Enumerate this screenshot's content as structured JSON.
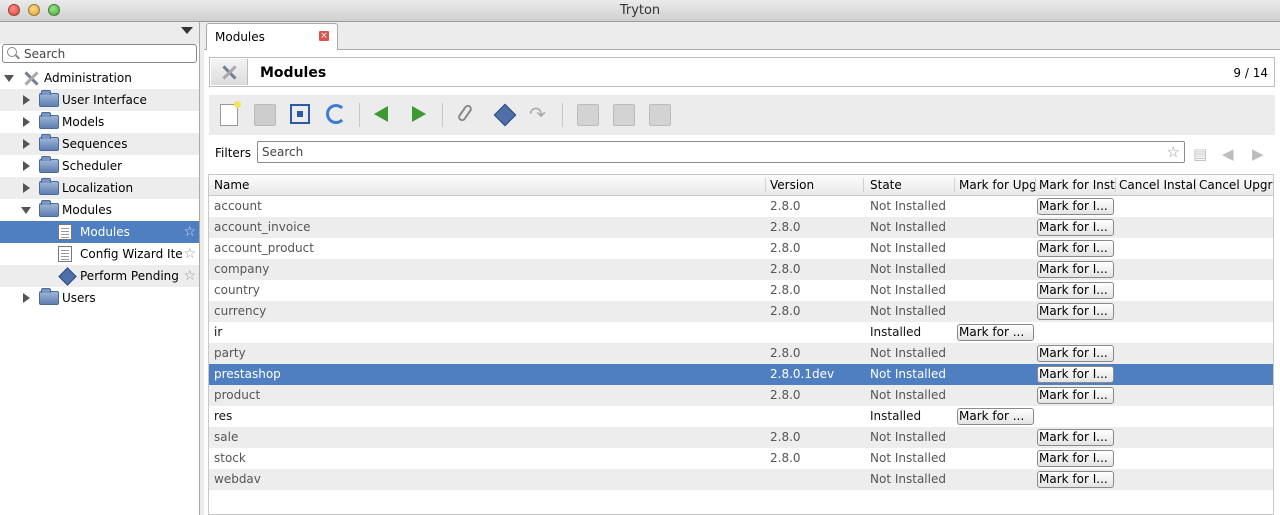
{
  "window": {
    "title": "Tryton"
  },
  "sidebar": {
    "search_placeholder": "Search",
    "items": [
      {
        "label": "Administration",
        "icon": "tools-icon"
      },
      {
        "label": "User Interface",
        "icon": "folder-icon"
      },
      {
        "label": "Models",
        "icon": "folder-icon"
      },
      {
        "label": "Sequences",
        "icon": "folder-icon"
      },
      {
        "label": "Scheduler",
        "icon": "folder-icon"
      },
      {
        "label": "Localization",
        "icon": "folder-icon"
      },
      {
        "label": "Modules",
        "icon": "folder-icon"
      },
      {
        "label": "Modules",
        "icon": "document-icon",
        "selected": true
      },
      {
        "label": "Config Wizard Ite",
        "icon": "document-icon"
      },
      {
        "label": "Perform Pending",
        "icon": "action-icon"
      },
      {
        "label": "Users",
        "icon": "folder-icon"
      }
    ]
  },
  "tab": {
    "label": "Modules",
    "close": "×"
  },
  "header": {
    "title": "Modules",
    "record_count": "9 / 14"
  },
  "toolbar": {
    "icons": [
      "new-icon",
      "save-icon",
      "switch-view-icon",
      "reload-icon",
      "previous-icon",
      "next-icon",
      "attachment-icon",
      "action-icon",
      "relate-icon",
      "report-icon",
      "email-icon",
      "print-icon"
    ]
  },
  "filters": {
    "label": "Filters",
    "placeholder": "Search"
  },
  "table": {
    "columns": [
      "Name",
      "Version",
      "State",
      "Mark for Upgrade",
      "Mark for Install",
      "Cancel Installation",
      "Cancel Upgrade"
    ],
    "button_label_install": "Mark for I...",
    "button_label_upgrade": "Mark for ...",
    "rows": [
      {
        "name": "account",
        "version": "2.8.0",
        "state": "Not Installed"
      },
      {
        "name": "account_invoice",
        "version": "2.8.0",
        "state": "Not Installed"
      },
      {
        "name": "account_product",
        "version": "2.8.0",
        "state": "Not Installed"
      },
      {
        "name": "company",
        "version": "2.8.0",
        "state": "Not Installed"
      },
      {
        "name": "country",
        "version": "2.8.0",
        "state": "Not Installed"
      },
      {
        "name": "currency",
        "version": "2.8.0",
        "state": "Not Installed"
      },
      {
        "name": "ir",
        "version": "",
        "state": "Installed"
      },
      {
        "name": "party",
        "version": "2.8.0",
        "state": "Not Installed"
      },
      {
        "name": "prestashop",
        "version": "2.8.0.1dev",
        "state": "Not Installed",
        "selected": true
      },
      {
        "name": "product",
        "version": "2.8.0",
        "state": "Not Installed"
      },
      {
        "name": "res",
        "version": "",
        "state": "Installed"
      },
      {
        "name": "sale",
        "version": "2.8.0",
        "state": "Not Installed"
      },
      {
        "name": "stock",
        "version": "2.8.0",
        "state": "Not Installed"
      },
      {
        "name": "webdav",
        "version": "",
        "state": "Not Installed"
      }
    ]
  }
}
